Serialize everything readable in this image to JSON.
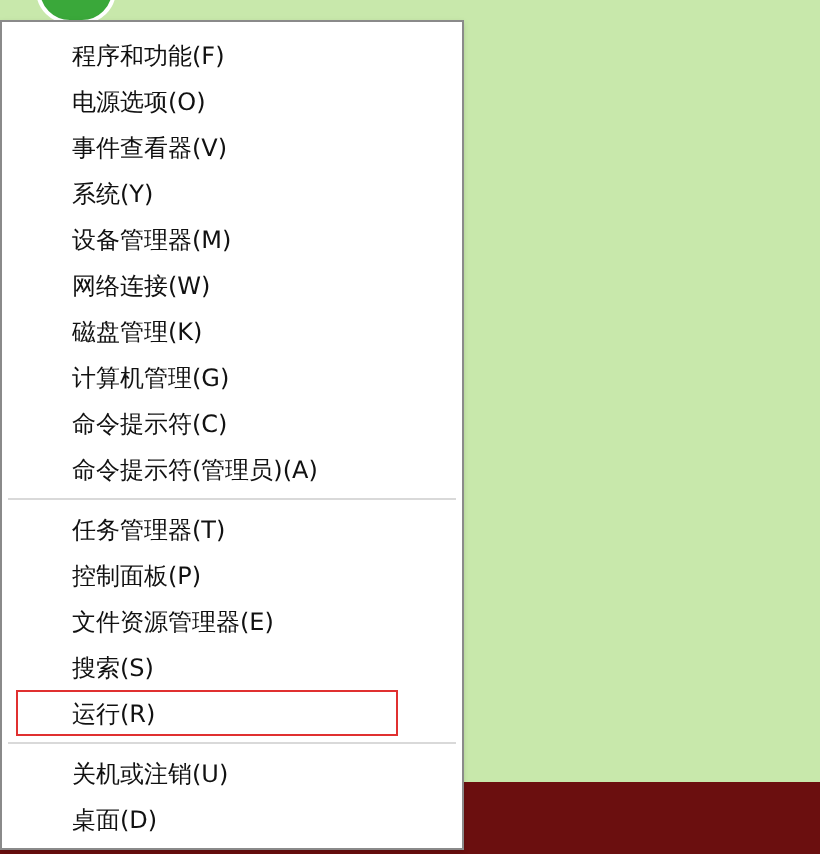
{
  "menu": {
    "groups": [
      {
        "items": [
          {
            "label": "程序和功能(F)",
            "highlighted": false
          },
          {
            "label": "电源选项(O)",
            "highlighted": false
          },
          {
            "label": "事件查看器(V)",
            "highlighted": false
          },
          {
            "label": "系统(Y)",
            "highlighted": false
          },
          {
            "label": "设备管理器(M)",
            "highlighted": false
          },
          {
            "label": "网络连接(W)",
            "highlighted": false
          },
          {
            "label": "磁盘管理(K)",
            "highlighted": false
          },
          {
            "label": "计算机管理(G)",
            "highlighted": false
          },
          {
            "label": "命令提示符(C)",
            "highlighted": false
          },
          {
            "label": "命令提示符(管理员)(A)",
            "highlighted": false
          }
        ]
      },
      {
        "items": [
          {
            "label": "任务管理器(T)",
            "highlighted": false
          },
          {
            "label": "控制面板(P)",
            "highlighted": false
          },
          {
            "label": "文件资源管理器(E)",
            "highlighted": false
          },
          {
            "label": "搜索(S)",
            "highlighted": false
          },
          {
            "label": "运行(R)",
            "highlighted": true
          }
        ]
      },
      {
        "items": [
          {
            "label": "关机或注销(U)",
            "highlighted": false
          },
          {
            "label": "桌面(D)",
            "highlighted": false
          }
        ]
      }
    ]
  }
}
